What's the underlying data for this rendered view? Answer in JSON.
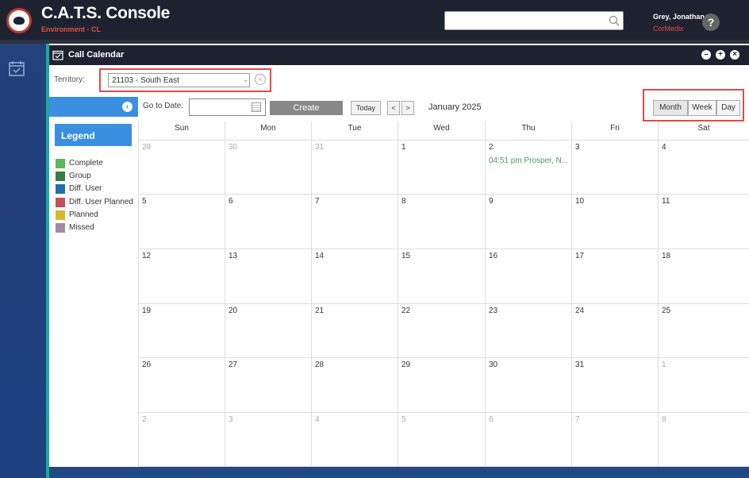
{
  "header": {
    "app_title": "C.A.T.S. Console",
    "environment": "Environment - CL",
    "search_placeholder": "",
    "user_name": "Grey, Jonathan",
    "user_org": "CorMedix",
    "help_label": "?"
  },
  "panel": {
    "title": "Call Calendar"
  },
  "territory": {
    "label": "Territory:",
    "value": "21103 - South East"
  },
  "toolbar": {
    "goto_label": "Go to Date:",
    "goto_value": "",
    "create_label": "Create",
    "today_label": "Today",
    "prev_label": "<",
    "next_label": ">",
    "month_label": "January 2025",
    "views": [
      "Month",
      "Week",
      "Day"
    ]
  },
  "legend": {
    "title": "Legend",
    "items": [
      {
        "label": "Complete",
        "color": "#5cb85c"
      },
      {
        "label": "Group",
        "color": "#3a7d44"
      },
      {
        "label": "Diff. User",
        "color": "#1f6fae"
      },
      {
        "label": "Diff. User Planned",
        "color": "#c0505a"
      },
      {
        "label": "Planned",
        "color": "#d4b92b"
      },
      {
        "label": "Missed",
        "color": "#a48aa0"
      }
    ]
  },
  "calendar": {
    "days": [
      "Sun",
      "Mon",
      "Tue",
      "Wed",
      "Thu",
      "Fri",
      "Sat"
    ],
    "weeks": [
      [
        {
          "d": "29",
          "o": true
        },
        {
          "d": "30",
          "o": true
        },
        {
          "d": "31",
          "o": true
        },
        {
          "d": "1"
        },
        {
          "d": "2",
          "event": "04:51 pm Prosper, N..."
        },
        {
          "d": "3"
        },
        {
          "d": "4"
        }
      ],
      [
        {
          "d": "5"
        },
        {
          "d": "6"
        },
        {
          "d": "7"
        },
        {
          "d": "8"
        },
        {
          "d": "9"
        },
        {
          "d": "10"
        },
        {
          "d": "11"
        }
      ],
      [
        {
          "d": "12"
        },
        {
          "d": "13"
        },
        {
          "d": "14"
        },
        {
          "d": "15"
        },
        {
          "d": "16"
        },
        {
          "d": "17"
        },
        {
          "d": "18"
        }
      ],
      [
        {
          "d": "19"
        },
        {
          "d": "20"
        },
        {
          "d": "21"
        },
        {
          "d": "22"
        },
        {
          "d": "23"
        },
        {
          "d": "24"
        },
        {
          "d": "25"
        }
      ],
      [
        {
          "d": "26"
        },
        {
          "d": "27"
        },
        {
          "d": "28"
        },
        {
          "d": "29"
        },
        {
          "d": "30"
        },
        {
          "d": "31"
        },
        {
          "d": "1",
          "o": true
        }
      ],
      [
        {
          "d": "2",
          "o": true
        },
        {
          "d": "3",
          "o": true
        },
        {
          "d": "4",
          "o": true
        },
        {
          "d": "5",
          "o": true
        },
        {
          "d": "6",
          "o": true
        },
        {
          "d": "7",
          "o": true
        },
        {
          "d": "8",
          "o": true
        }
      ]
    ]
  }
}
